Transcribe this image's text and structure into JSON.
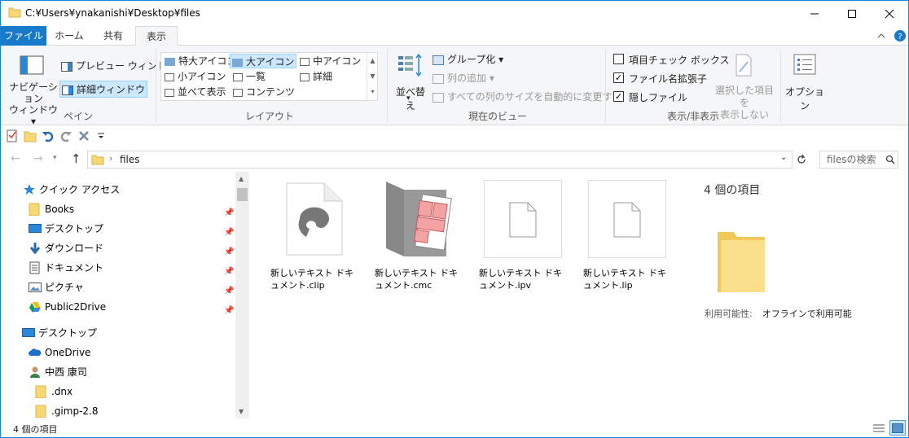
{
  "window": {
    "title": "C:¥Users¥ynakanishi¥Desktop¥files",
    "controls": [
      "minimize",
      "maximize",
      "close"
    ]
  },
  "tabs": [
    {
      "label": "ファイル"
    },
    {
      "label": "ホーム"
    },
    {
      "label": "共有"
    },
    {
      "label": "表示"
    }
  ],
  "ribbon": {
    "pane": {
      "nav_pane": "ナビゲーション",
      "nav_pane_2": "ウィンドウ",
      "preview": "プレビュー ウィンドウ",
      "details": "詳細ウィンドウ",
      "label": "ペイン"
    },
    "layout": {
      "items": [
        "特大アイコン",
        "大アイコン",
        "中アイコン",
        "小アイコン",
        "一覧",
        "詳細",
        "並べて表示",
        "コンテンツ"
      ],
      "label": "レイアウト"
    },
    "current_view": {
      "sort": "並べ替え",
      "group": "グループ化",
      "add_column": "列の追加",
      "fit_columns": "すべての列のサイズを自動的に変更する",
      "label": "現在のビュー"
    },
    "show_hide": {
      "item_checkbox": "項目チェック ボックス",
      "extensions": "ファイル名拡張子",
      "hidden": "隠しファイル",
      "hide_selected_1": "選択した項目を",
      "hide_selected_2": "表示しない",
      "label": "表示/非表示"
    },
    "options": "オプション"
  },
  "address": {
    "path": "files",
    "search_placeholder": "filesの検索"
  },
  "nav": {
    "quick_access": "クイック アクセス",
    "items": [
      {
        "label": "Books"
      },
      {
        "label": "デスクトップ"
      },
      {
        "label": "ダウンロード"
      },
      {
        "label": "ドキュメント"
      },
      {
        "label": "ピクチャ"
      },
      {
        "label": "Public2Drive"
      }
    ],
    "desktop": "デスクトップ",
    "onedrive": "OneDrive",
    "user": "中西 康司",
    "sub": [
      ".dnx",
      ".gimp-2.8"
    ]
  },
  "files": [
    {
      "name": "新しいテキスト ドキュメント.clip"
    },
    {
      "name": "新しいテキスト ドキュメント.cmc"
    },
    {
      "name": "新しいテキスト ドキュメント.ipv"
    },
    {
      "name": "新しいテキスト ドキュメント.lip"
    }
  ],
  "details": {
    "count": "4 個の項目",
    "availability_label": "利用可能性:",
    "availability_value": "オフラインで利用可能"
  },
  "status": {
    "count": "4 個の項目"
  },
  "colors": {
    "accent": "#1979ca",
    "selection": "#cce8ff",
    "folder": "#f8d775"
  }
}
